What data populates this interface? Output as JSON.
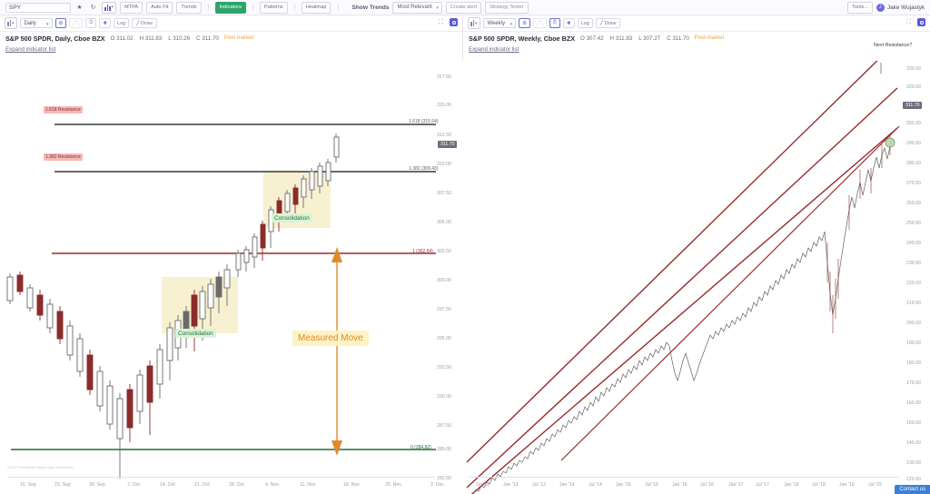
{
  "topbar": {
    "symbol_value": "SPY",
    "symbol_placeholder": "Symbol",
    "star_icon": "star-icon",
    "refresh_icon": "refresh-icon",
    "chart_type_icon": "bar-chart-icon",
    "buttons": [
      {
        "label": "MTPA",
        "active": false
      },
      {
        "label": "Auto Fit",
        "active": false
      },
      {
        "label": "Trends",
        "active": false
      },
      {
        "label": "Indicators",
        "active": true
      },
      {
        "label": "Patterns",
        "active": false
      },
      {
        "label": "Heatmap",
        "active": false
      }
    ],
    "show_trends_label": "Show Trends",
    "relevance_select": "Most Relevant",
    "create_alert_label": "Create alert",
    "strategy_tester_label": "Strategy Tester",
    "tools_label": "Tools...",
    "user_name": "Jake Wujastyk",
    "user_initial": "J"
  },
  "left": {
    "toolbar": {
      "layout_icon": "layout-icon",
      "timeframe": "Daily",
      "settings_icon": "gear-icon",
      "measure_icon": "measure-icon",
      "clock_icon": "clock-icon",
      "magnet_icon": "magnet-icon",
      "log_label": "Log",
      "draw_label": "Draw",
      "fullscreen_icon": "fullscreen-icon",
      "snapshot_icon": "camera-icon"
    },
    "quote": {
      "title": "S&P 500 SPDR, Daily, Cboe BZX",
      "open_label": "O",
      "open": "311.02",
      "high_label": "H",
      "high": "311.83",
      "low_label": "L",
      "low": "310.26",
      "close_label": "C",
      "close": "311.70",
      "session": "Post-market"
    },
    "expand_link": "Expand indicator list",
    "footnote": "©2019 TrendSpider. Market data via Barchart.",
    "levels": [
      {
        "name": "1.618 Resistance",
        "value": "1.618 (315.64)",
        "tag": "res"
      },
      {
        "name": "1.382 Resistance",
        "value": "1.382 (309.43)",
        "tag": "res"
      },
      {
        "name": "1",
        "value": "1 (302.64)",
        "tag": "red"
      },
      {
        "name": "0",
        "value": "0 (284.82)",
        "tag": "green"
      }
    ],
    "current_price_tag": "311.70",
    "annotations": [
      {
        "label": "Consolidation",
        "kind": "consolidation"
      },
      {
        "label": "Consolidation",
        "kind": "consolidation"
      },
      {
        "label": "Measured Move",
        "kind": "measured-move"
      }
    ]
  },
  "right": {
    "toolbar": {
      "layout_icon": "layout-icon",
      "timeframe": "Weekly",
      "settings_icon": "gear-icon",
      "measure_icon": "measure-icon",
      "clock_icon": "clock-icon",
      "magnet_icon": "magnet-icon",
      "log_label": "Log",
      "draw_label": "Draw",
      "fullscreen_icon": "fullscreen-icon",
      "snapshot_icon": "camera-icon"
    },
    "quote": {
      "title": "S&P 500 SPDR, Weekly, Cboe BZX",
      "open_label": "O",
      "open": "307.42",
      "high_label": "H",
      "high": "311.83",
      "low_label": "L",
      "low": "307.27",
      "close_label": "C",
      "close": "311.70",
      "session": "Post-market"
    },
    "expand_link": "Expand indicator list",
    "current_price_tag": "311.70",
    "annotations": [
      {
        "label": "Next Resistance?",
        "kind": "next-resistance"
      }
    ],
    "contact_label": "Contact us"
  },
  "chart_data": [
    {
      "type": "line",
      "id": "daily-spy",
      "title": "S&P 500 SPDR, Daily, Cboe BZX",
      "xlabel": "",
      "ylabel": "",
      "grid": false,
      "ylim": [
        282.5,
        318.75
      ],
      "yticks": [
        317.5,
        315.0,
        312.5,
        310.0,
        307.5,
        305.0,
        302.5,
        300.0,
        297.5,
        295.0,
        292.5,
        290.0,
        287.5,
        285.0,
        282.5
      ],
      "ytick_labels": [
        "317.50",
        "315.00",
        "312.50",
        "310.00",
        "307.50",
        "305.00",
        "302.50",
        "300.00",
        "297.50",
        "295.00",
        "292.50",
        "290.00",
        "287.50",
        "285.00",
        "282.50"
      ],
      "xtick_labels": [
        "16. Sep",
        "23. Sep",
        "30. Sep",
        "7. Oct",
        "14. Oct",
        "21. Oct",
        "28. Oct",
        "4. Nov",
        "11. Nov",
        "18. Nov",
        "25. Nov",
        "2. Dec"
      ],
      "hlines": [
        {
          "label": "1.618 Resistance",
          "value": 315.64,
          "color": "#111111"
        },
        {
          "label": "1.382 Resistance",
          "value": 309.43,
          "color": "#111111"
        },
        {
          "label": "1",
          "value": 302.64,
          "color": "#9a2b2b"
        },
        {
          "label": "0",
          "value": 284.82,
          "color": "#1f6b3a"
        }
      ],
      "measured_move": {
        "from": 284.82,
        "to": 302.64,
        "label": "Measured Move",
        "color": "#e08a2e"
      },
      "candles": [
        {
          "o": 296.7,
          "h": 297.6,
          "l": 294.2,
          "c": 295.1
        },
        {
          "o": 295.2,
          "h": 297.1,
          "l": 294.6,
          "c": 296.6
        },
        {
          "o": 296.8,
          "h": 298.0,
          "l": 296.0,
          "c": 297.4
        },
        {
          "o": 297.4,
          "h": 298.2,
          "l": 296.4,
          "c": 296.8
        },
        {
          "o": 296.9,
          "h": 298.6,
          "l": 296.5,
          "c": 298.2
        },
        {
          "o": 298.3,
          "h": 299.1,
          "l": 296.8,
          "c": 297.2
        },
        {
          "o": 297.1,
          "h": 298.3,
          "l": 295.6,
          "c": 296.1
        },
        {
          "o": 296.2,
          "h": 297.0,
          "l": 293.5,
          "c": 294.1
        },
        {
          "o": 294.0,
          "h": 294.8,
          "l": 290.9,
          "c": 291.6
        },
        {
          "o": 291.4,
          "h": 293.5,
          "l": 290.4,
          "c": 293.0
        },
        {
          "o": 292.9,
          "h": 294.2,
          "l": 291.8,
          "c": 292.2
        },
        {
          "o": 292.0,
          "h": 293.0,
          "l": 288.6,
          "c": 289.2
        },
        {
          "o": 289.0,
          "h": 290.4,
          "l": 286.0,
          "c": 287.0
        },
        {
          "o": 287.2,
          "h": 290.8,
          "l": 286.6,
          "c": 290.2
        },
        {
          "o": 290.4,
          "h": 292.4,
          "l": 289.6,
          "c": 291.8
        },
        {
          "o": 291.6,
          "h": 293.6,
          "l": 290.2,
          "c": 293.1
        },
        {
          "o": 293.2,
          "h": 294.5,
          "l": 292.1,
          "c": 293.5
        },
        {
          "o": 293.6,
          "h": 295.2,
          "l": 292.4,
          "c": 294.6
        },
        {
          "o": 294.5,
          "h": 296.0,
          "l": 290.4,
          "c": 291.0
        },
        {
          "o": 291.2,
          "h": 292.2,
          "l": 284.9,
          "c": 285.5
        },
        {
          "o": 285.6,
          "h": 288.4,
          "l": 284.8,
          "c": 288.0
        },
        {
          "o": 288.1,
          "h": 290.6,
          "l": 287.2,
          "c": 290.0
        },
        {
          "o": 290.2,
          "h": 293.2,
          "l": 289.6,
          "c": 292.6
        },
        {
          "o": 292.8,
          "h": 294.6,
          "l": 292.0,
          "c": 294.0
        },
        {
          "o": 294.1,
          "h": 295.6,
          "l": 293.2,
          "c": 295.0
        },
        {
          "o": 295.2,
          "h": 296.9,
          "l": 294.4,
          "c": 296.4
        },
        {
          "o": 296.5,
          "h": 298.6,
          "l": 296.0,
          "c": 298.2
        },
        {
          "o": 298.4,
          "h": 299.4,
          "l": 297.2,
          "c": 298.0
        },
        {
          "o": 298.1,
          "h": 300.2,
          "l": 297.6,
          "c": 299.8
        },
        {
          "o": 299.9,
          "h": 301.0,
          "l": 298.8,
          "c": 300.2
        },
        {
          "o": 300.4,
          "h": 302.2,
          "l": 299.8,
          "c": 301.6
        },
        {
          "o": 301.8,
          "h": 303.0,
          "l": 301.0,
          "c": 302.4
        },
        {
          "o": 302.5,
          "h": 303.6,
          "l": 301.6,
          "c": 302.2
        },
        {
          "o": 302.3,
          "h": 304.0,
          "l": 301.8,
          "c": 303.6
        },
        {
          "o": 303.8,
          "h": 305.4,
          "l": 303.2,
          "c": 305.0
        },
        {
          "o": 305.1,
          "h": 306.6,
          "l": 304.2,
          "c": 305.4
        },
        {
          "o": 305.5,
          "h": 307.4,
          "l": 305.0,
          "c": 307.0
        },
        {
          "o": 307.2,
          "h": 308.6,
          "l": 306.4,
          "c": 308.0
        },
        {
          "o": 308.2,
          "h": 309.6,
          "l": 307.6,
          "c": 309.2
        },
        {
          "o": 309.3,
          "h": 310.4,
          "l": 308.6,
          "c": 309.6
        },
        {
          "o": 309.8,
          "h": 311.2,
          "l": 309.0,
          "c": 310.8
        },
        {
          "o": 310.9,
          "h": 311.8,
          "l": 310.2,
          "c": 311.7
        }
      ]
    },
    {
      "type": "line",
      "id": "weekly-spy",
      "title": "S&P 500 SPDR, Weekly, Cboe BZX",
      "xlabel": "",
      "ylabel": "",
      "grid": false,
      "ylim": [
        120,
        335
      ],
      "yticks": [
        330,
        320,
        310,
        300,
        290,
        280,
        270,
        260,
        250,
        240,
        230,
        220,
        210,
        200,
        190,
        180,
        170,
        160,
        150,
        140,
        130,
        120
      ],
      "ytick_labels": [
        "330.00",
        "320.00",
        "310.00",
        "300.00",
        "290.00",
        "280.00",
        "270.00",
        "260.00",
        "250.00",
        "240.00",
        "230.00",
        "220.00",
        "210.00",
        "200.00",
        "190.00",
        "180.00",
        "170.00",
        "160.00",
        "150.00",
        "140.00",
        "130.00",
        "120.00"
      ],
      "xtick_labels": [
        "Jul '12",
        "Jan '13",
        "Jul '13",
        "Jan '14",
        "Jul '14",
        "Jan '15",
        "Jul '15",
        "Jan '16",
        "Jul '16",
        "Jan '17",
        "Jul '17",
        "Jan '18",
        "Jul '18",
        "Jan '19",
        "Jul '19"
      ],
      "trendlines": [
        {
          "name": "upper-channel",
          "color": "#9a2b2b"
        },
        {
          "name": "mid-channel",
          "color": "#9a2b2b"
        },
        {
          "name": "lower-channel",
          "color": "#9a2b2b"
        },
        {
          "name": "resistance-fan",
          "color": "#9a2b2b"
        }
      ],
      "current_price": 311.7
    }
  ]
}
